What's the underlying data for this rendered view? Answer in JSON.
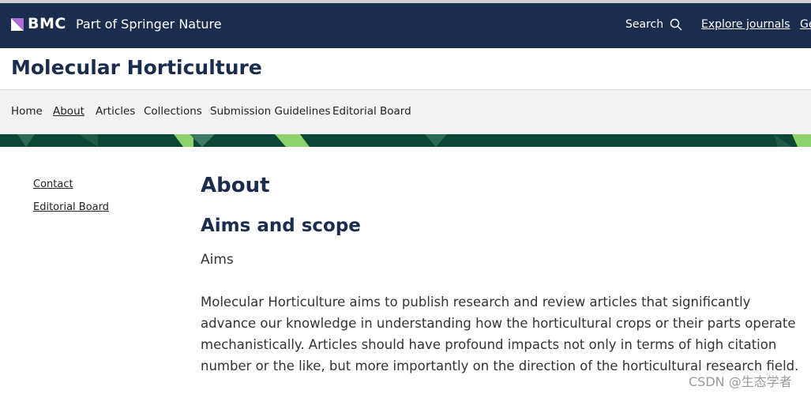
{
  "top_bar": {
    "brand_name": "BMC",
    "brand_tagline": "Part of Springer Nature",
    "search_label": "Search",
    "explore_label": "Explore journals",
    "get_label": "Ge"
  },
  "journal": {
    "title": "Molecular Horticulture"
  },
  "nav": {
    "items": [
      {
        "label": "Home",
        "active": false
      },
      {
        "label": "About",
        "active": true
      },
      {
        "label": "Articles",
        "active": false
      },
      {
        "label": "Collections",
        "active": false
      },
      {
        "label": "Submission Guidelines",
        "active": false
      },
      {
        "label": "Editorial Board",
        "active": false
      }
    ]
  },
  "sidebar": {
    "links": [
      {
        "label": "Contact"
      },
      {
        "label": "Editorial Board"
      }
    ]
  },
  "main": {
    "heading": "About",
    "section_heading": "Aims and scope",
    "sub_label": "Aims",
    "paragraph": "Molecular Horticulture aims to publish research and review articles that significantly advance our knowledge in understanding how the horticultural crops or their parts operate mechanistically. Articles should have profound impacts not only in terms of high citation number or the like, but more importantly on the direction of the horticultural research field."
  },
  "watermark": "CSDN @生态学者",
  "colors": {
    "header_navy": "#1b2d4e",
    "nav_bg": "#f2f2f2",
    "banner_green": "#0b4637",
    "banner_accent": "#8fd16a"
  }
}
